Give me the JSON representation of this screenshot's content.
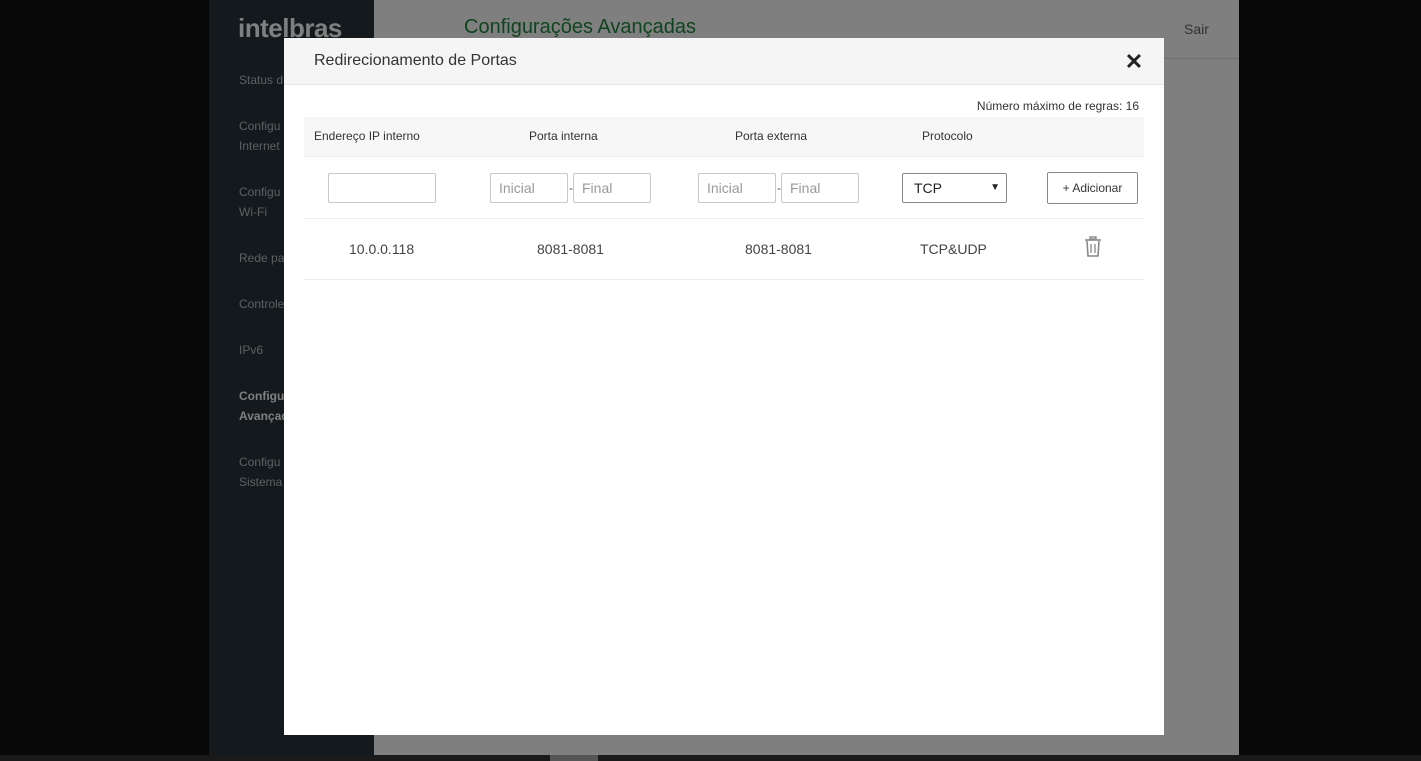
{
  "app": {
    "logo": "intelbras",
    "page_title": "Configurações Avançadas",
    "logout": "Sair",
    "sidebar": [
      {
        "label": "Status d"
      },
      {
        "label": "Configu\nInternet"
      },
      {
        "label": "Configu\nWi-Fi"
      },
      {
        "label": "Rede pa"
      },
      {
        "label": "Controle"
      },
      {
        "label": "IPv6"
      },
      {
        "label": "Configu\nAvançad",
        "active": true
      },
      {
        "label": "Configu\nSistema"
      }
    ]
  },
  "modal": {
    "title": "Redirecionamento de Portas",
    "close_icon": "close-icon",
    "max_rules": "Número máximo de regras: 16",
    "columns": [
      "Endereço IP interno",
      "Porta interna",
      "Porta externa",
      "Protocolo"
    ],
    "form": {
      "ip_value": "",
      "internal_start_placeholder": "Inicial",
      "internal_end_placeholder": "Final",
      "external_start_placeholder": "Inicial",
      "external_end_placeholder": "Final",
      "separator": "-",
      "protocol_selected": "TCP",
      "add_label": "+ Adicionar"
    },
    "rows": [
      {
        "ip": "10.0.0.118",
        "internal": "8081-8081",
        "external": "8081-8081",
        "protocol": "TCP&UDP",
        "delete_icon": "trash-icon"
      }
    ]
  }
}
